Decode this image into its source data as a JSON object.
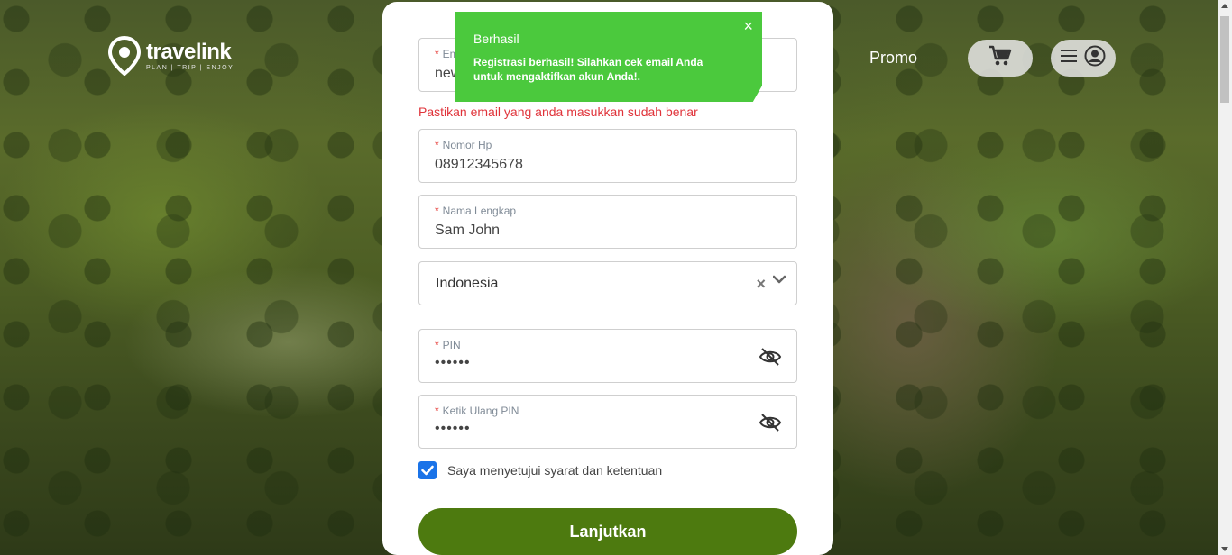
{
  "header": {
    "logo_name": "travelink",
    "logo_tagline": "PLAN | TRIP | ENJOY",
    "promo_label": "Promo"
  },
  "form": {
    "email": {
      "label_prefix": "*",
      "label": "Em",
      "value": "new"
    },
    "email_error": "Pastikan email yang anda masukkan sudah benar",
    "phone": {
      "label_prefix": "*",
      "label": "Nomor Hp",
      "value": "08912345678"
    },
    "full_name": {
      "label_prefix": "*",
      "label": "Nama Lengkap",
      "value": "Sam John"
    },
    "country": {
      "value": "Indonesia",
      "clear_glyph": "×"
    },
    "pin": {
      "label_prefix": "*",
      "label": "PIN",
      "value": "••••••"
    },
    "pin_confirm": {
      "label_prefix": "*",
      "label": "Ketik Ulang PIN",
      "value": "••••••"
    },
    "agree_label": "Saya menyetujui syarat dan ketentuan",
    "agree_checked": true,
    "submit_label": "Lanjutkan"
  },
  "toast": {
    "title": "Berhasil",
    "message": "Registrasi berhasil! Silahkan cek email Anda untuk mengaktifkan akun Anda!.",
    "close_glyph": "×",
    "color": "#4bc93d"
  },
  "colors": {
    "primary_button": "#4d7a0f",
    "error": "#e0333a",
    "checkbox": "#1a73e8"
  },
  "icons": {
    "logo": "map-pin-icon",
    "cart": "shopping-cart-icon",
    "menu": "hamburger-menu-icon",
    "account": "user-circle-icon",
    "pin_visibility": "eye-slash-icon",
    "dropdown": "chevron-down-icon"
  }
}
